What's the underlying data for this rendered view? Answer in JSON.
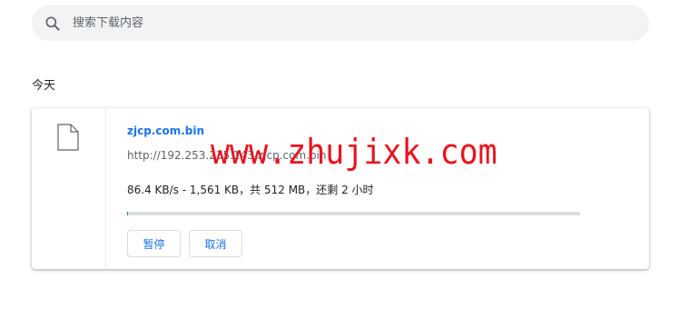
{
  "search": {
    "placeholder": "搜索下载内容"
  },
  "section": {
    "title": "今天"
  },
  "download": {
    "file_name": "zjcp.com.bin",
    "url": "http://192.253.235.143/zjcp.com.bin",
    "status": "86.4 KB/s - 1,561 KB，共 512 MB，还剩 2 小时",
    "progress_fraction": 0.003,
    "pause_label": "暂停",
    "cancel_label": "取消"
  },
  "watermark": {
    "text": "www.zhujixk.com"
  },
  "colors": {
    "accent": "#1a73e8",
    "watermark": "#e8141e",
    "search_bg": "#f1f3f4",
    "track": "#dadce0"
  }
}
